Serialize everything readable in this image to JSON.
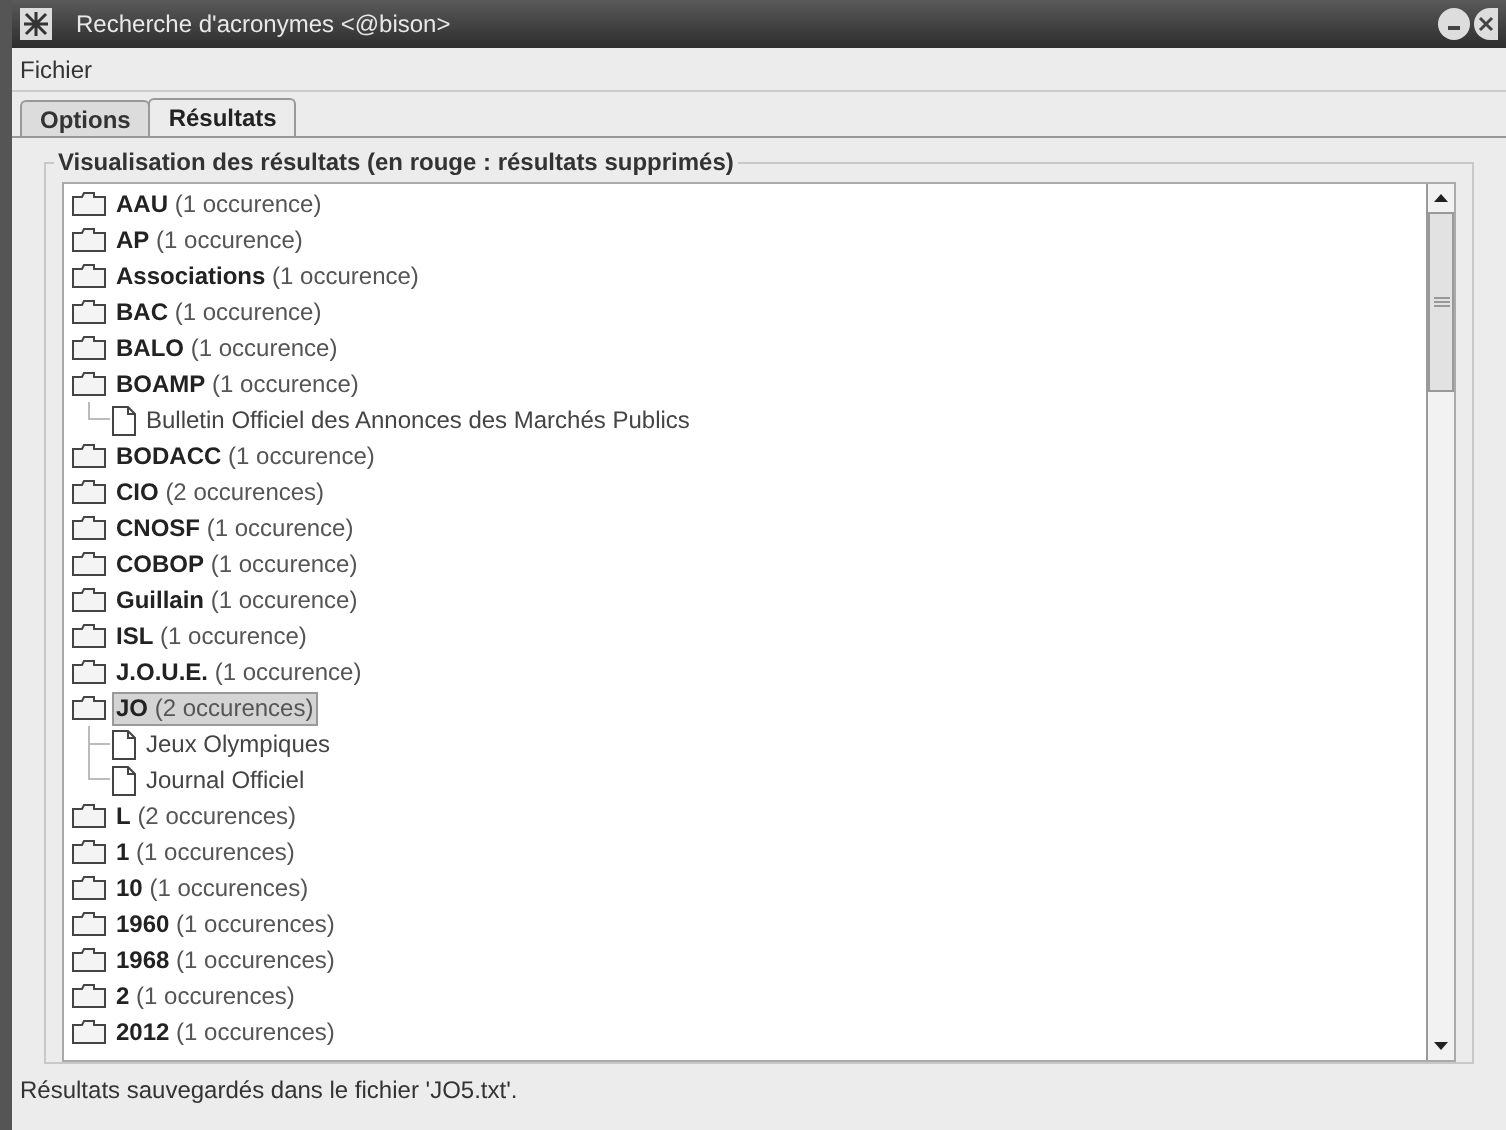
{
  "window": {
    "title": "Recherche d'acronymes <@bison>"
  },
  "menu": [
    "Fichier"
  ],
  "tabs": [
    {
      "label": "Options",
      "selected": false
    },
    {
      "label": "Résultats",
      "selected": true
    }
  ],
  "group": {
    "title": "Visualisation des résultats (en rouge : résultats supprimés)"
  },
  "tree": [
    {
      "acronym": "AAU",
      "count": "(1 occurence)",
      "selected": false
    },
    {
      "acronym": "AP",
      "count": "(1 occurence)",
      "selected": false
    },
    {
      "acronym": "Associations",
      "count": "(1 occurence)",
      "selected": false
    },
    {
      "acronym": "BAC",
      "count": "(1 occurence)",
      "selected": false
    },
    {
      "acronym": "BALO",
      "count": "(1 occurence)",
      "selected": false
    },
    {
      "acronym": "BOAMP",
      "count": "(1 occurence)",
      "selected": false,
      "children": [
        {
          "label": "Bulletin Officiel des Annonces des Marchés Publics"
        }
      ]
    },
    {
      "acronym": "BODACC",
      "count": "(1 occurence)",
      "selected": false
    },
    {
      "acronym": "CIO",
      "count": "(2 occurences)",
      "selected": false
    },
    {
      "acronym": "CNOSF",
      "count": "(1 occurence)",
      "selected": false
    },
    {
      "acronym": "COBOP",
      "count": "(1 occurence)",
      "selected": false
    },
    {
      "acronym": "Guillain",
      "count": "(1 occurence)",
      "selected": false
    },
    {
      "acronym": "ISL",
      "count": "(1 occurence)",
      "selected": false
    },
    {
      "acronym": "J.O.U.E.",
      "count": "(1 occurence)",
      "selected": false
    },
    {
      "acronym": "JO",
      "count": "(2 occurences)",
      "selected": true,
      "children": [
        {
          "label": "Jeux Olympiques"
        },
        {
          "label": "Journal Officiel"
        }
      ]
    },
    {
      "acronym": "L",
      "count": "(2 occurences)",
      "selected": false
    },
    {
      "acronym": "1",
      "count": "(1 occurences)",
      "selected": false
    },
    {
      "acronym": "10",
      "count": "(1 occurences)",
      "selected": false
    },
    {
      "acronym": "1960",
      "count": "(1 occurences)",
      "selected": false
    },
    {
      "acronym": "1968",
      "count": "(1 occurences)",
      "selected": false
    },
    {
      "acronym": "2",
      "count": "(1 occurences)",
      "selected": false
    },
    {
      "acronym": "2012",
      "count": "(1 occurences)",
      "selected": false
    }
  ],
  "status_bar": "Résultats sauvegardés dans le fichier 'JO5.txt'."
}
